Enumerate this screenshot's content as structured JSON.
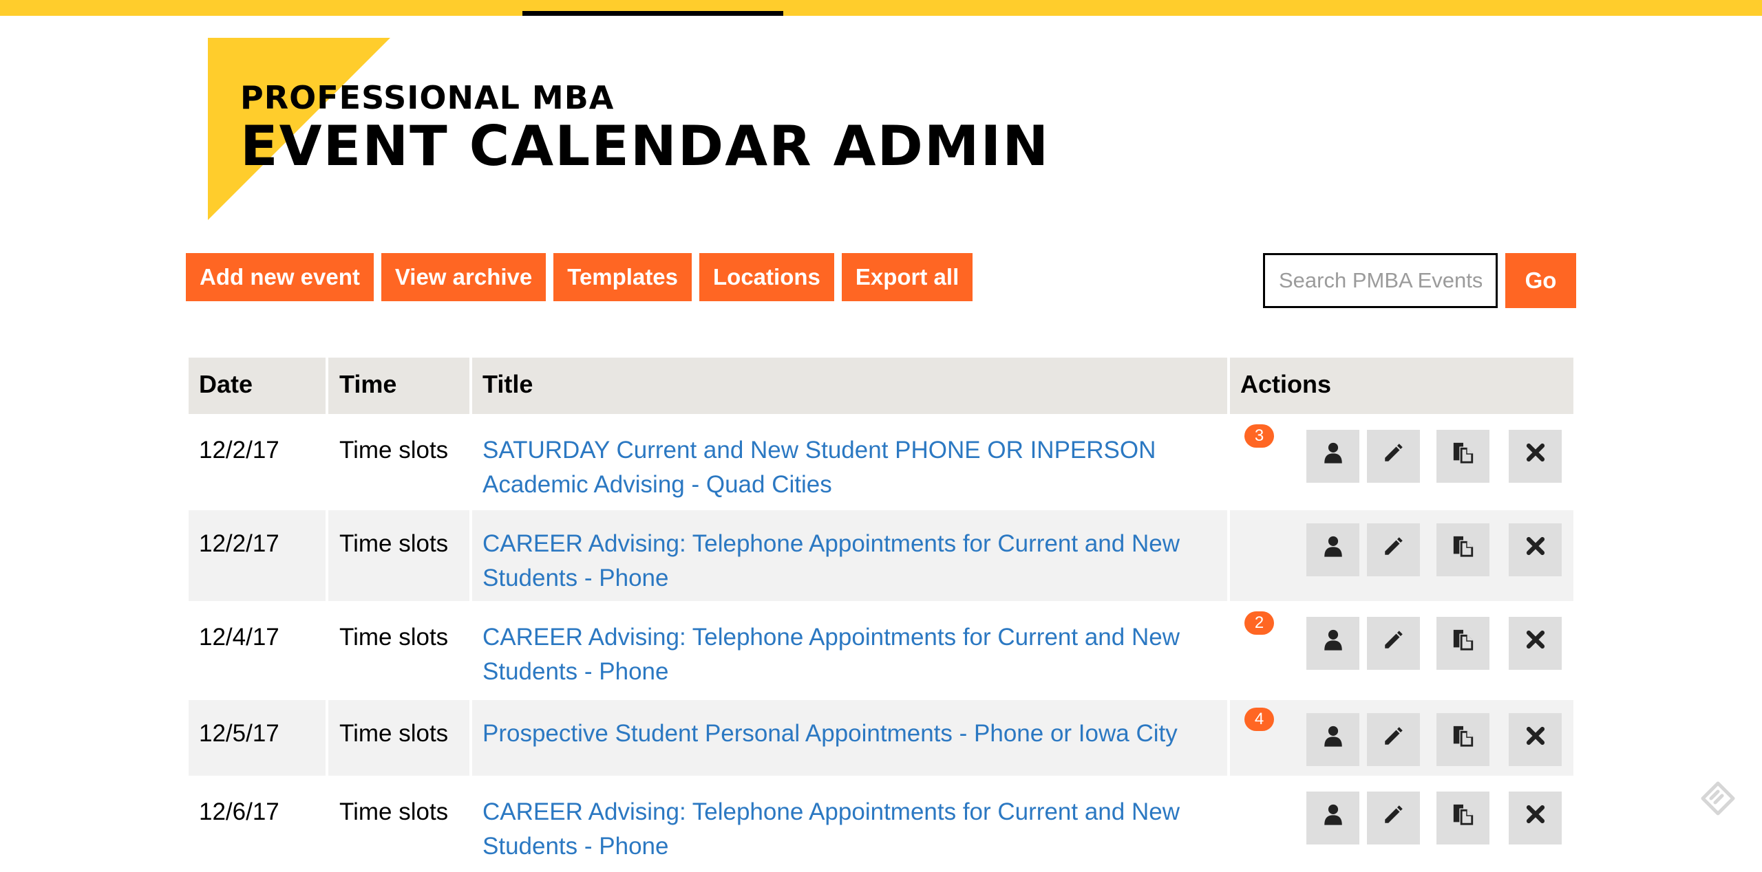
{
  "header": {
    "subtitle": "PROFESSIONAL MBA",
    "title": "EVENT CALENDAR ADMIN"
  },
  "toolbar": {
    "buttons": [
      "Add new event",
      "View archive",
      "Templates",
      "Locations",
      "Export all"
    ]
  },
  "search": {
    "placeholder": "Search PMBA Events",
    "value": "",
    "go_label": "Go"
  },
  "table": {
    "headers": {
      "date": "Date",
      "time": "Time",
      "title": "Title",
      "actions": "Actions"
    },
    "rows": [
      {
        "date": "12/2/17",
        "time": "Time slots",
        "title": "SATURDAY Current and New Student PHONE OR INPERSON Academic Advising - Quad Cities",
        "badge": "3"
      },
      {
        "date": "12/2/17",
        "time": "Time slots",
        "title": "CAREER Advising: Telephone Appointments for Current and New Students - Phone",
        "badge": ""
      },
      {
        "date": "12/4/17",
        "time": "Time slots",
        "title": "CAREER Advising: Telephone Appointments for Current and New Students - Phone",
        "badge": "2"
      },
      {
        "date": "12/5/17",
        "time": "Time slots",
        "title": "Prospective Student Personal Appointments - Phone or Iowa City",
        "badge": "4"
      },
      {
        "date": "12/6/17",
        "time": "Time slots",
        "title": "CAREER Advising: Telephone Appointments for Current and New Students - Phone",
        "badge": ""
      }
    ],
    "action_icons": [
      "person-icon",
      "pencil-icon",
      "copy-icon",
      "close-icon"
    ]
  },
  "colors": {
    "brand_yellow": "#ffcd2c",
    "accent_orange": "#ff6623",
    "link_blue": "#2b78c2",
    "header_bg": "#e8e6e2",
    "row_alt_bg": "#f2f2f2",
    "action_bg": "#dedede"
  }
}
